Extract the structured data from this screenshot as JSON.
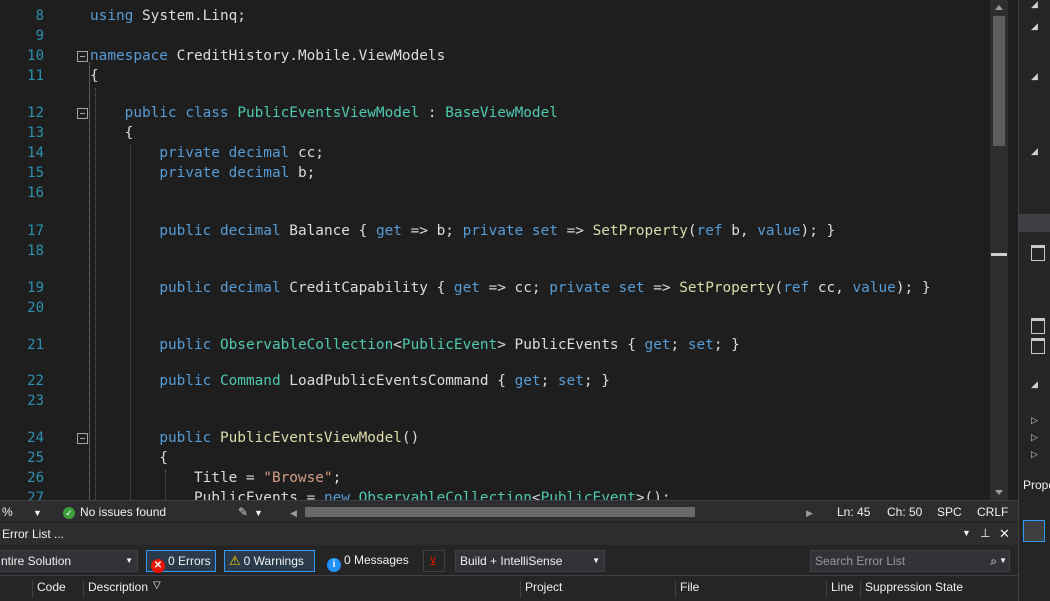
{
  "editor": {
    "lines": [
      {
        "n": "8",
        "tokens": [
          [
            "k",
            "using"
          ],
          [
            "p",
            " System.Linq;"
          ]
        ]
      },
      {
        "n": "9",
        "tokens": []
      },
      {
        "n": "10",
        "tokens": [
          [
            "k",
            "namespace"
          ],
          [
            "p",
            " CreditHistory.Mobile.ViewModels"
          ]
        ]
      },
      {
        "n": "11",
        "tokens": [
          [
            "p",
            "{"
          ]
        ]
      },
      {
        "n": "12",
        "tokens": [
          [
            "p",
            "    "
          ],
          [
            "k",
            "public"
          ],
          [
            "p",
            " "
          ],
          [
            "k",
            "class"
          ],
          [
            "p",
            " "
          ],
          [
            "t",
            "PublicEventsViewModel"
          ],
          [
            "p",
            " : "
          ],
          [
            "t",
            "BaseViewModel"
          ]
        ]
      },
      {
        "n": "13",
        "tokens": [
          [
            "p",
            "    {"
          ]
        ]
      },
      {
        "n": "14",
        "tokens": [
          [
            "p",
            "        "
          ],
          [
            "k",
            "private"
          ],
          [
            "p",
            " "
          ],
          [
            "k",
            "decimal"
          ],
          [
            "p",
            " cc;"
          ]
        ]
      },
      {
        "n": "15",
        "tokens": [
          [
            "p",
            "        "
          ],
          [
            "k",
            "private"
          ],
          [
            "p",
            " "
          ],
          [
            "k",
            "decimal"
          ],
          [
            "p",
            " b;"
          ]
        ]
      },
      {
        "n": "16",
        "tokens": []
      },
      {
        "n": "17",
        "tokens": [
          [
            "p",
            "        "
          ],
          [
            "k",
            "public"
          ],
          [
            "p",
            " "
          ],
          [
            "k",
            "decimal"
          ],
          [
            "p",
            " Balance { "
          ],
          [
            "k",
            "get"
          ],
          [
            "p",
            " => b; "
          ],
          [
            "k",
            "private"
          ],
          [
            "p",
            " "
          ],
          [
            "k",
            "set"
          ],
          [
            "p",
            " => "
          ],
          [
            "m",
            "SetProperty"
          ],
          [
            "p",
            "("
          ],
          [
            "k",
            "ref"
          ],
          [
            "p",
            " b, "
          ],
          [
            "k",
            "value"
          ],
          [
            "p",
            "); }"
          ]
        ]
      },
      {
        "n": "18",
        "tokens": []
      },
      {
        "n": "19",
        "tokens": [
          [
            "p",
            "        "
          ],
          [
            "k",
            "public"
          ],
          [
            "p",
            " "
          ],
          [
            "k",
            "decimal"
          ],
          [
            "p",
            " CreditCapability { "
          ],
          [
            "k",
            "get"
          ],
          [
            "p",
            " => cc; "
          ],
          [
            "k",
            "private"
          ],
          [
            "p",
            " "
          ],
          [
            "k",
            "set"
          ],
          [
            "p",
            " => "
          ],
          [
            "m",
            "SetProperty"
          ],
          [
            "p",
            "("
          ],
          [
            "k",
            "ref"
          ],
          [
            "p",
            " cc, "
          ],
          [
            "k",
            "value"
          ],
          [
            "p",
            "); }"
          ]
        ]
      },
      {
        "n": "20",
        "tokens": []
      },
      {
        "n": "21",
        "tokens": [
          [
            "p",
            "        "
          ],
          [
            "k",
            "public"
          ],
          [
            "p",
            " "
          ],
          [
            "t",
            "ObservableCollection"
          ],
          [
            "p",
            "<"
          ],
          [
            "t",
            "PublicEvent"
          ],
          [
            "p",
            "> PublicEvents { "
          ],
          [
            "k",
            "get"
          ],
          [
            "p",
            "; "
          ],
          [
            "k",
            "set"
          ],
          [
            "p",
            "; }"
          ]
        ]
      },
      {
        "n": "22",
        "tokens": [
          [
            "p",
            "        "
          ],
          [
            "k",
            "public"
          ],
          [
            "p",
            " "
          ],
          [
            "t",
            "Command"
          ],
          [
            "p",
            " LoadPublicEventsCommand { "
          ],
          [
            "k",
            "get"
          ],
          [
            "p",
            "; "
          ],
          [
            "k",
            "set"
          ],
          [
            "p",
            "; }"
          ]
        ]
      },
      {
        "n": "23",
        "tokens": []
      },
      {
        "n": "24",
        "tokens": [
          [
            "p",
            "        "
          ],
          [
            "k",
            "public"
          ],
          [
            "p",
            " "
          ],
          [
            "m",
            "PublicEventsViewModel"
          ],
          [
            "p",
            "()"
          ]
        ]
      },
      {
        "n": "25",
        "tokens": [
          [
            "p",
            "        {"
          ]
        ]
      },
      {
        "n": "26",
        "tokens": [
          [
            "p",
            "            Title = "
          ],
          [
            "s",
            "\"Browse\""
          ],
          [
            "p",
            ";"
          ]
        ]
      },
      {
        "n": "27",
        "tokens": [
          [
            "p",
            "            PublicEvents = "
          ],
          [
            "k",
            "new"
          ],
          [
            "p",
            " "
          ],
          [
            "t",
            "ObservableCollection"
          ],
          [
            "p",
            "<"
          ],
          [
            "t",
            "PublicEvent"
          ],
          [
            "p",
            ">();"
          ]
        ]
      }
    ]
  },
  "statusbar": {
    "zoom": "%",
    "issues": "No issues found",
    "ln": "Ln: 45",
    "ch": "Ch: 50",
    "spc": "SPC",
    "crlf": "CRLF"
  },
  "right_panel": {
    "properties_label": "Prope"
  },
  "error_list": {
    "title": "Error List ...",
    "scope": "ntire Solution",
    "errors": "0 Errors",
    "warnings": "0 Warnings",
    "messages": "0 Messages",
    "build_filter": "Build + IntelliSense",
    "search_placeholder": "Search Error List",
    "columns": {
      "code": "Code",
      "description": "Description",
      "project": "Project",
      "file": "File",
      "line": "Line",
      "suppression": "Suppression State"
    }
  },
  "colors": {
    "keyword": "#569cd6",
    "type": "#4ec9b0",
    "method": "#dcdcaa",
    "string": "#d69d85",
    "line_number": "#2b91af"
  }
}
